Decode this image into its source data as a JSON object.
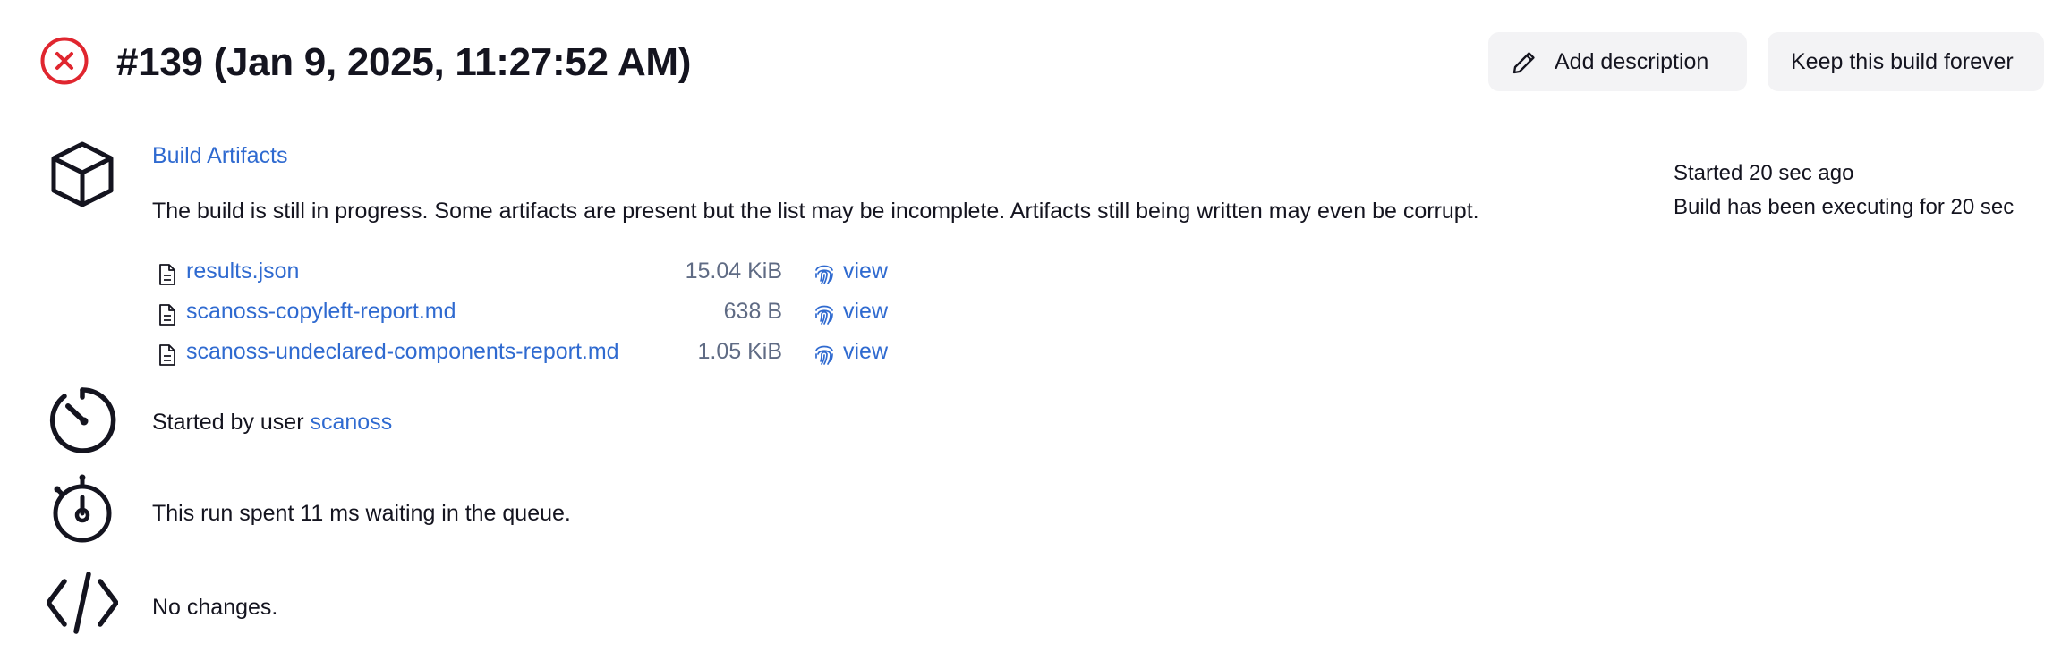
{
  "header": {
    "status_icon": "failed-circle-x-icon",
    "status_color": "#e0262f",
    "title": "#139 (Jan 9, 2025, 11:27:52 AM)",
    "add_description_label": "Add description",
    "keep_forever_label": "Keep this build forever"
  },
  "timing": {
    "started": "Started 20 sec ago",
    "executing": "Build has been executing for 20 sec"
  },
  "artifacts": {
    "icon": "package-icon",
    "heading": "Build Artifacts",
    "note": "The build is still in progress. Some artifacts are present but the list may be incomplete. Artifacts still being written may even be corrupt.",
    "items": [
      {
        "name": "results.json",
        "size": "15.04 KiB",
        "view_label": "view"
      },
      {
        "name": "scanoss-copyleft-report.md",
        "size": "638 B",
        "view_label": "view"
      },
      {
        "name": "scanoss-undeclared-components-report.md",
        "size": "1.05 KiB",
        "view_label": "view"
      }
    ]
  },
  "cause": {
    "icon": "speedometer-icon",
    "prefix": "Started by user ",
    "user": "scanoss"
  },
  "queue": {
    "icon": "stopwatch-icon",
    "text": "This run spent 11 ms waiting in the queue."
  },
  "changes": {
    "icon": "code-icon",
    "text": "No changes."
  },
  "colors": {
    "link": "#2f6ad0",
    "text": "#14141f",
    "muted": "#5f6b84",
    "button_bg": "#f3f3f5"
  }
}
